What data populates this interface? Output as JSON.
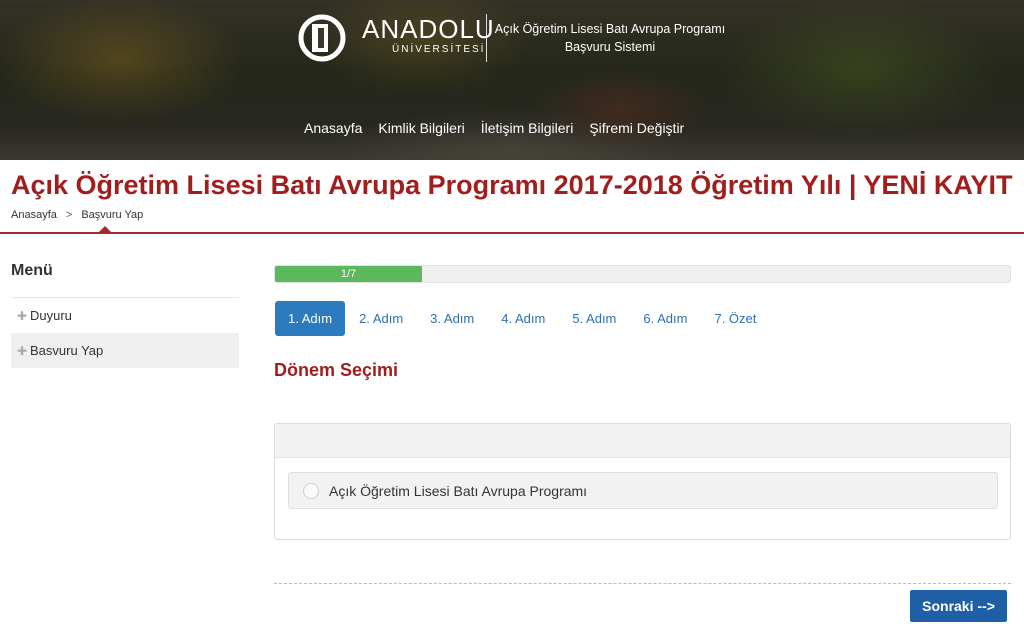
{
  "header": {
    "logo_name": "ANADOLU",
    "logo_sub": "ÜNİVERSİTESİ",
    "system_title_line1": "Açık Öğretim Lisesi Batı Avrupa Programı",
    "system_title_line2": "Başvuru Sistemi",
    "nav": [
      "Anasayfa",
      "Kimlik Bilgileri",
      "İletişim Bilgileri",
      "Şifremi Değiştir"
    ]
  },
  "page": {
    "title": "Açık Öğretim Lisesi Batı Avrupa Programı 2017-2018 Öğretim Yılı | YENİ KAYIT",
    "breadcrumb": [
      "Anasayfa",
      "Başvuru Yap"
    ],
    "breadcrumb_separator": ">"
  },
  "sidebar": {
    "title": "Menü",
    "items": [
      {
        "label": "Duyuru",
        "active": false
      },
      {
        "label": "Basvuru Yap",
        "active": true
      }
    ]
  },
  "wizard": {
    "progress_label": "1/7",
    "progress_fraction": 0.2,
    "steps": [
      "1. Adım",
      "2. Adım",
      "3. Adım",
      "4. Adım",
      "5. Adım",
      "6. Adım",
      "7. Özet"
    ],
    "active_step": 0,
    "section_title": "Dönem Seçimi",
    "options": [
      "Açık Öğretim Lisesi Batı Avrupa Programı"
    ],
    "next_label": "Sonraki -->"
  },
  "colors": {
    "title": "#a01e1e",
    "progress": "#5cb85c",
    "active_step": "#2d7bbf",
    "button": "#1f5fa6"
  },
  "icons": {
    "logo": "anadolu-logo-icon",
    "breadcrumb_separator": "chevron-right-icon",
    "menu_bullet": "plus-icon",
    "option": "radio-icon"
  }
}
